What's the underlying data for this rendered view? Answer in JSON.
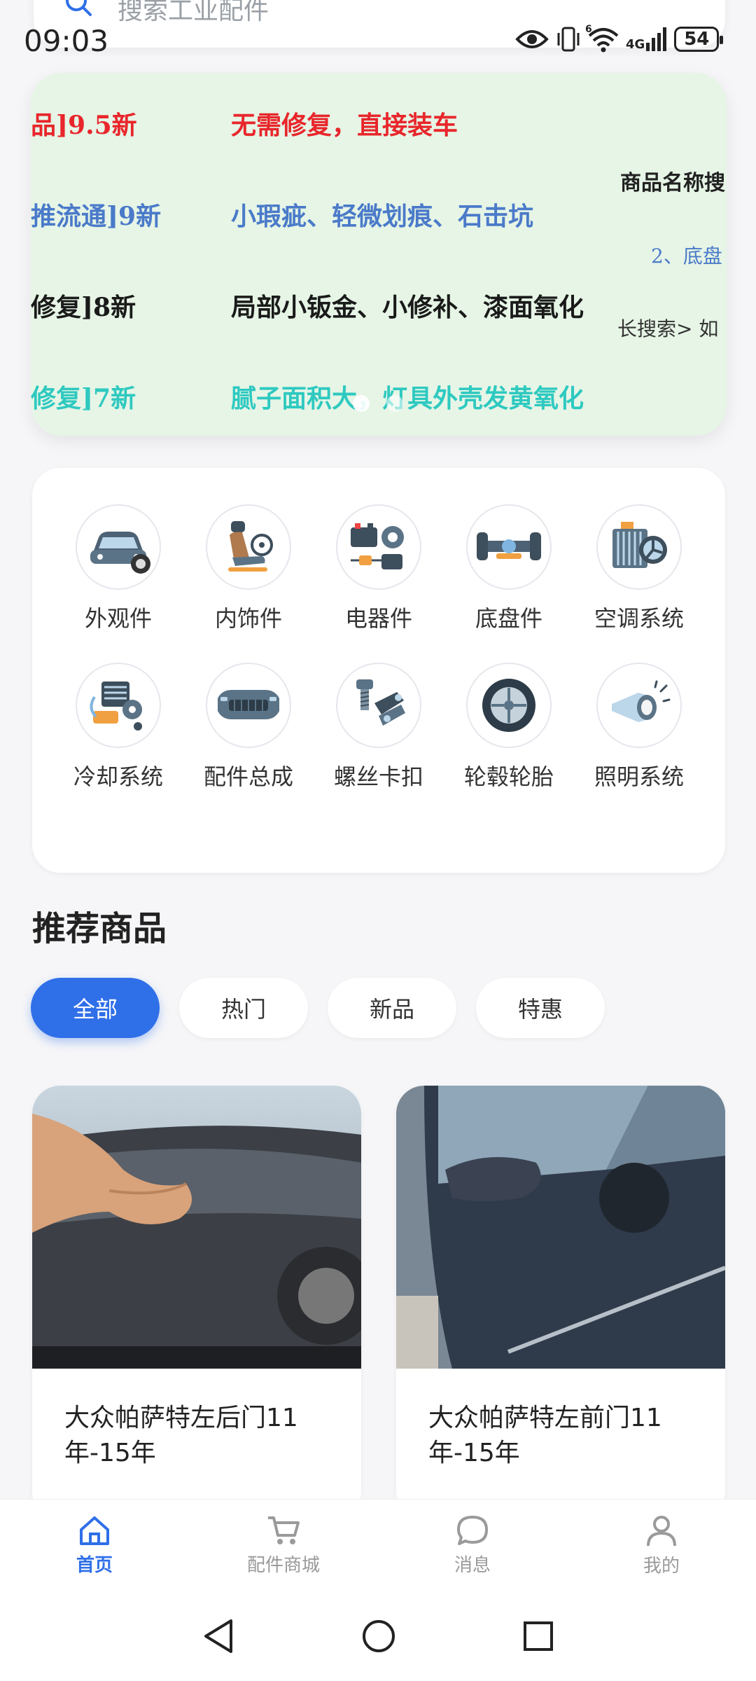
{
  "search": {
    "placeholder": "搜索工业配件"
  },
  "status_bar": {
    "time": "09:03",
    "battery": "54",
    "network": "4G",
    "wifi_badge": "6"
  },
  "banner": {
    "rows": [
      {
        "grade": "品]9.5新",
        "desc": "无需修复，直接装车",
        "color": "#e8262b"
      },
      {
        "grade": "推流通]9新",
        "desc": "小瑕疵、轻微划痕、石击坑",
        "color": "#4a7ac9"
      },
      {
        "grade": "修复]8新",
        "desc": "局部小钣金、小修补、漆面氧化",
        "color": "#1a1a1a"
      },
      {
        "grade": "修复]7新",
        "desc": "腻子面积大，灯具外壳发黄氧化",
        "color": "#2ec9c0"
      }
    ],
    "side_texts": [
      "商品名称搜",
      "2、底盘",
      "长搜索> 如"
    ],
    "slide_count": 2,
    "active_slide": 0
  },
  "categories": [
    {
      "label": "外观件",
      "icon": "car-exterior-icon"
    },
    {
      "label": "内饰件",
      "icon": "car-seat-icon"
    },
    {
      "label": "电器件",
      "icon": "electrical-parts-icon"
    },
    {
      "label": "底盘件",
      "icon": "chassis-icon"
    },
    {
      "label": "空调系统",
      "icon": "ac-system-icon"
    },
    {
      "label": "冷却系统",
      "icon": "cooling-system-icon"
    },
    {
      "label": "配件总成",
      "icon": "bumper-assembly-icon"
    },
    {
      "label": "螺丝卡扣",
      "icon": "screw-clip-icon"
    },
    {
      "label": "轮毂轮胎",
      "icon": "wheel-tire-icon"
    },
    {
      "label": "照明系统",
      "icon": "headlight-icon"
    }
  ],
  "recommend": {
    "title": "推荐商品"
  },
  "filters": [
    "全部",
    "热门",
    "新品",
    "特惠"
  ],
  "products": [
    {
      "name": "大众帕萨特左后门11年-15年"
    },
    {
      "name": "大众帕萨特左前门11年-15年"
    }
  ],
  "nav": [
    {
      "label": "首页",
      "icon": "home-icon",
      "active": true
    },
    {
      "label": "配件商城",
      "icon": "cart-icon",
      "active": false
    },
    {
      "label": "消息",
      "icon": "message-icon",
      "active": false
    },
    {
      "label": "我的",
      "icon": "user-icon",
      "active": false
    }
  ],
  "colors": {
    "accent": "#2f6fe8",
    "background": "#f6f6f8"
  }
}
